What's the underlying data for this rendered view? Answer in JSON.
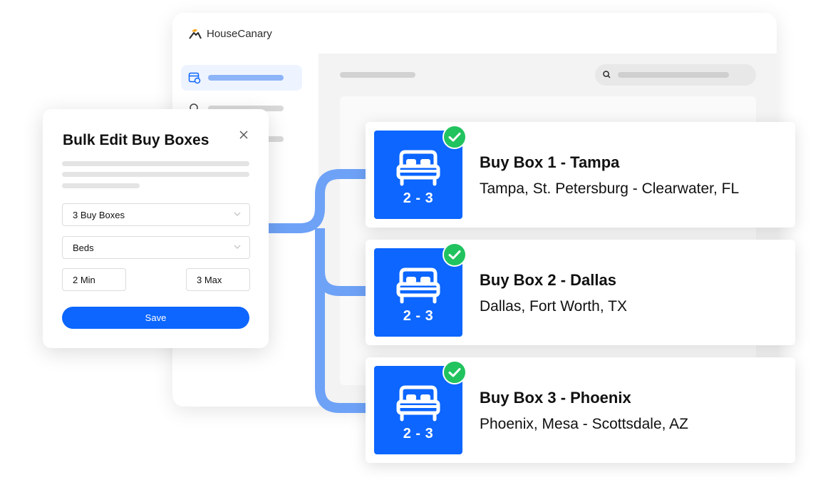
{
  "app": {
    "brand_name": "HouseCanary",
    "brand_icon": "canary-bird-logo"
  },
  "colors": {
    "accent": "#0c66ff",
    "connector": "#6ea2f7",
    "success": "#21c35f",
    "sidebar_active_bg": "#eef4ff"
  },
  "modal": {
    "title": "Bulk Edit Buy Boxes",
    "buy_boxes_select": "3 Buy Boxes",
    "criteria_select": "Beds",
    "min_field": "2 Min",
    "max_field": "3 Max",
    "save_label": "Save"
  },
  "buy_boxes": [
    {
      "title": "Buy Box 1 - Tampa",
      "location": "Tampa, St. Petersburg - Clearwater, FL",
      "beds": "2 - 3",
      "status": "checked"
    },
    {
      "title": "Buy Box 2 - Dallas",
      "location": "Dallas, Fort Worth, TX",
      "beds": "2 - 3",
      "status": "checked"
    },
    {
      "title": "Buy Box 3 - Phoenix",
      "location": "Phoenix, Mesa - Scottsdale, AZ",
      "beds": "2 - 3",
      "status": "checked"
    }
  ]
}
